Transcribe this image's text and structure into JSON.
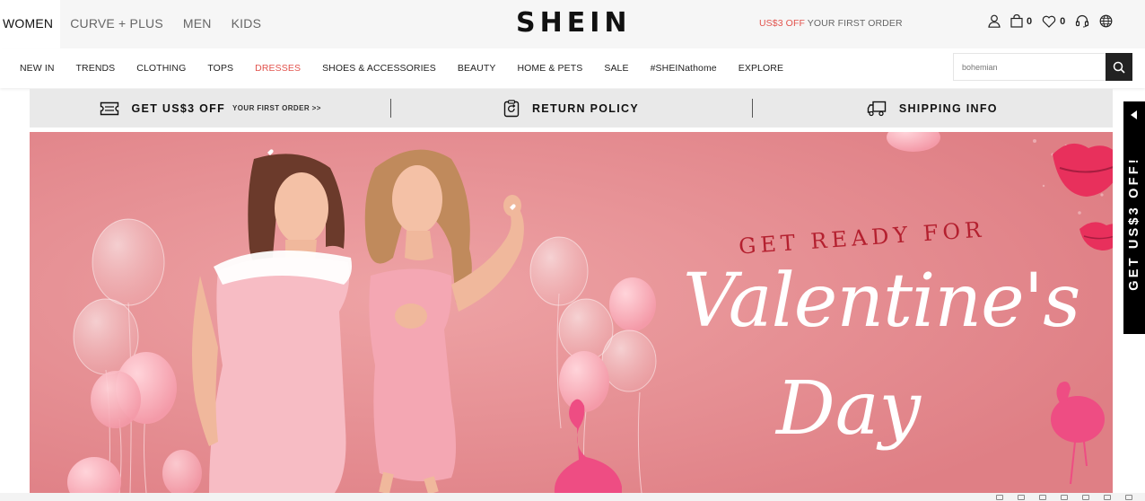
{
  "header": {
    "categories": [
      "WOMEN",
      "CURVE + PLUS",
      "MEN",
      "KIDS"
    ],
    "logo": "SHEIN",
    "promo": {
      "highlight": "US$3 OFF",
      "text": " YOUR FIRST ORDER"
    },
    "bag_count": "0",
    "wishlist_count": "0"
  },
  "nav": {
    "items": [
      "NEW IN",
      "TRENDS",
      "CLOTHING",
      "TOPS",
      "DRESSES",
      "SHOES & ACCESSORIES",
      "BEAUTY",
      "HOME & PETS",
      "SALE",
      "#SHEINathome",
      "EXPLORE"
    ],
    "highlight_color": "#e2534d"
  },
  "search": {
    "placeholder": "bohemian"
  },
  "promo_strip": {
    "items": [
      {
        "label": "GET US$3 OFF",
        "sub": "YOUR FIRST ORDER >>",
        "icon": "coupon-icon"
      },
      {
        "label": "RETURN POLICY",
        "sub": "",
        "icon": "return-icon"
      },
      {
        "label": "SHIPPING INFO",
        "sub": "",
        "icon": "truck-icon"
      }
    ]
  },
  "hero": {
    "kicker": "GET READY FOR",
    "title": "Valentine's",
    "subtitle": "Day",
    "background": "#e3878c"
  },
  "side_tab": {
    "label": "GET US$3 OFF!"
  }
}
